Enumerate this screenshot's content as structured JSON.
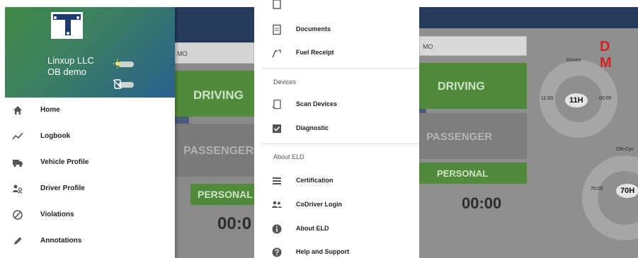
{
  "drawer": {
    "company_line1": "Linxup LLC",
    "company_line2": "OB demo",
    "items": [
      {
        "label": "Home",
        "icon": "home-icon"
      },
      {
        "label": "Logbook",
        "icon": "trend-icon"
      },
      {
        "label": "Vehicle Profile",
        "icon": "truck-icon"
      },
      {
        "label": "Driver Profile",
        "icon": "people-icon"
      },
      {
        "label": "Violations",
        "icon": "prohibited-icon"
      },
      {
        "label": "Annotations",
        "icon": "pencil-icon"
      }
    ]
  },
  "background_left": {
    "search_text": "MO",
    "driving": "DRIVING",
    "passenger": "PASSENGER",
    "personal": "PERSONAL",
    "clock": "00:0"
  },
  "menu": {
    "items_top": [
      {
        "label": "Documents",
        "icon": "document-icon"
      },
      {
        "label": "Fuel Receipt",
        "icon": "fuel-pump-icon"
      }
    ],
    "devices_header": "Devices",
    "devices_items": [
      {
        "label": "Scan Devices",
        "icon": "scan-device-icon"
      },
      {
        "label": "Diagnostic",
        "icon": "checkbox-icon"
      }
    ],
    "about_header": "About ELD",
    "about_items": [
      {
        "label": "Certification",
        "icon": "list-icon"
      },
      {
        "label": "CoDriver Login",
        "icon": "codriver-icon"
      },
      {
        "label": "About ELD",
        "icon": "info-icon"
      },
      {
        "label": "Help and Support",
        "icon": "help-icon"
      }
    ]
  },
  "right": {
    "search_text": "MO",
    "driving": "DRIVING",
    "passenger": "PASSENGER",
    "personal": "PERSONAL",
    "clock": "00:00",
    "dm": "D M",
    "driven_label": "Driven",
    "driven_left": "11:00",
    "driven_value": "11H",
    "driven_right": "00:00",
    "cycle_label": "ON-Cyc",
    "cycle_left": "70:00",
    "cycle_value": "70H"
  },
  "colors": {
    "green_button": "#4f8b3b",
    "navy_topbar": "#263a5c",
    "red_dm": "#d62020"
  }
}
